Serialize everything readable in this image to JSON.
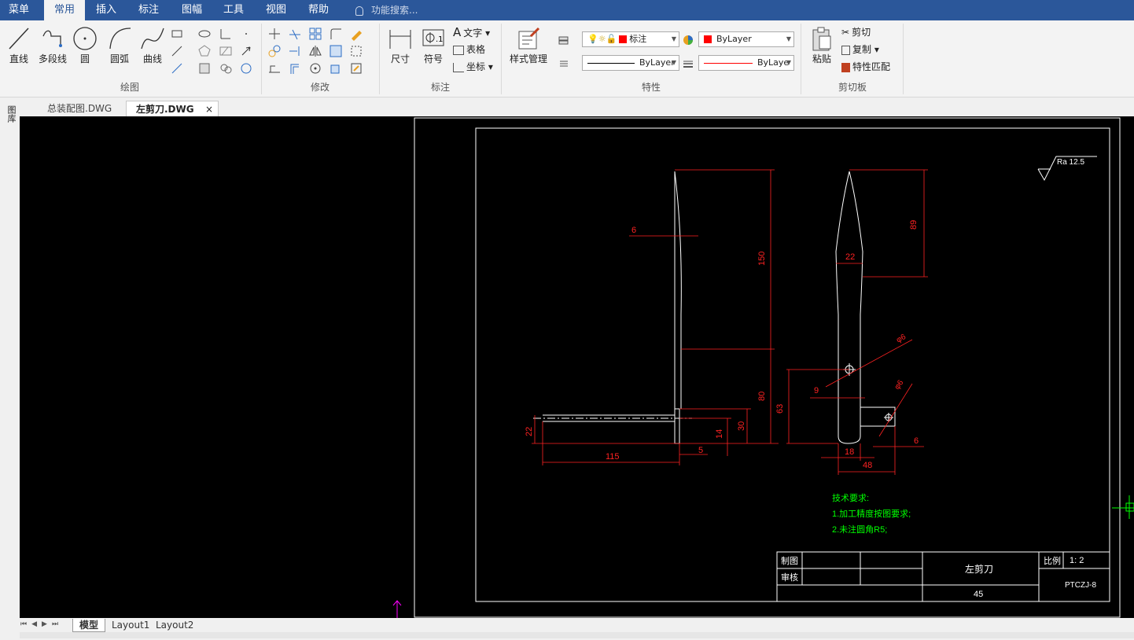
{
  "menu": {
    "tabs": [
      "菜单",
      "常用",
      "插入",
      "标注",
      "图幅",
      "工具",
      "视图",
      "帮助"
    ],
    "active": "常用",
    "search_placeholder": "功能搜索..."
  },
  "ribbon": {
    "draw": {
      "label": "绘图",
      "line": "直线",
      "polyline": "多段线",
      "circle": "圆",
      "arc": "圆弧",
      "curve": "曲线"
    },
    "modify": {
      "label": "修改"
    },
    "annotate": {
      "label": "标注",
      "dimension": "尺寸",
      "symbol": "符号",
      "text": "文字",
      "table": "表格",
      "coord": "坐标"
    },
    "properties": {
      "label": "特性",
      "style_manager": "样式管理",
      "layer": "标注",
      "color": "ByLayer",
      "linetype": "ByLayer",
      "lineweight": "ByLaye"
    },
    "clipboard": {
      "label": "剪切板",
      "paste": "粘贴",
      "cut": "剪切",
      "copy": "复制",
      "match": "特性匹配"
    }
  },
  "doc_tabs": [
    {
      "name": "总装配图.DWG",
      "active": false
    },
    {
      "name": "左剪刀.DWG",
      "active": true
    }
  ],
  "left_tool": "图库",
  "drawing": {
    "roughness": "Ra 12.5",
    "dims": {
      "d6": "6",
      "d150": "150",
      "d22a": "22",
      "d80": "80",
      "d30": "30",
      "d14": "14",
      "d115": "115",
      "d5": "5",
      "d63": "63",
      "d89": "89",
      "d22b": "22",
      "d9": "9",
      "d18": "18",
      "d48": "48",
      "d6b": "6",
      "phi6a": "φ6",
      "phi6b": "φ6"
    },
    "tech_req_title": "技术要求:",
    "tech_req_1": "1.加工精度按图要求;",
    "tech_req_2": "2.未注圆角R5;",
    "title_block": {
      "drawn": "制图",
      "review": "审核",
      "part_name": "左剪刀",
      "scale_label": "比例",
      "scale_value": "1: 2",
      "material": "45",
      "code": "PTCZJ-8"
    }
  },
  "layout_tabs": [
    "模型",
    "Layout1",
    "Layout2"
  ],
  "layout_active": "模型",
  "colors": {
    "accent": "#2b579a",
    "dim": "#ff2020",
    "geometry": "#ffffff",
    "tech_text": "#00ff00"
  }
}
